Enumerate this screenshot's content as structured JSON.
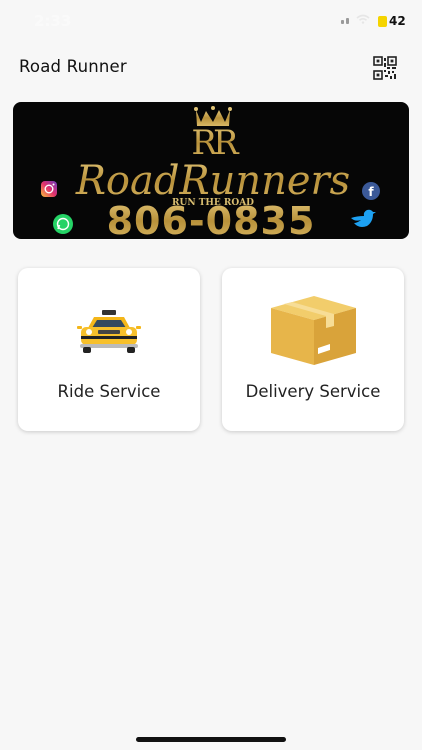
{
  "status_bar": {
    "time": "2:33",
    "battery_level": "42"
  },
  "app_bar": {
    "title": "Road Runner",
    "scan_icon": "qr-code-icon"
  },
  "banner": {
    "brand_text": "RoadRunners",
    "tagline": "RUN THE ROAD",
    "phone": "806-0835",
    "social_icons": [
      "instagram-icon",
      "facebook-icon",
      "whatsapp-icon",
      "twitter-icon"
    ]
  },
  "services": [
    {
      "label": "Ride Service",
      "icon": "taxi-icon"
    },
    {
      "label": "Delivery Service",
      "icon": "package-box-icon"
    }
  ],
  "colors": {
    "accent_gold": "#c9a64e",
    "background": "#f7f7f7",
    "card": "#ffffff"
  }
}
